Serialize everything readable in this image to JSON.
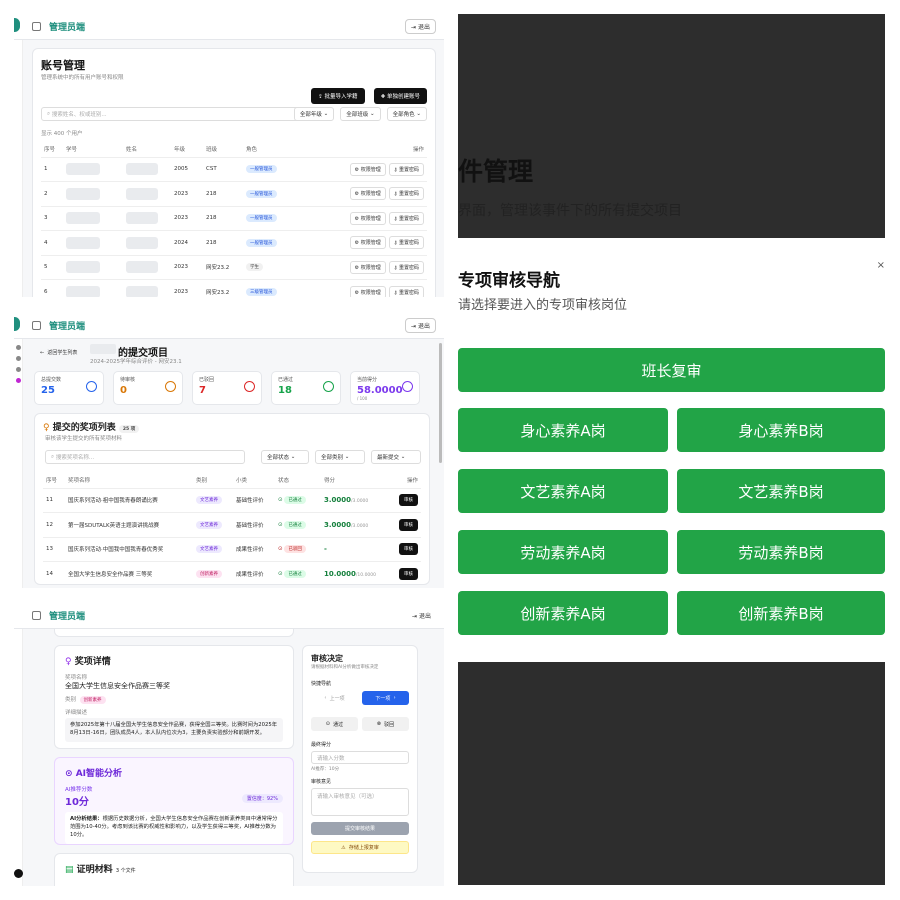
{
  "brand": "管理员端",
  "exit_label": "退出",
  "p1": {
    "title": "账号管理",
    "subtitle": "管理系统中的所有用户账号和权限",
    "btn_import": "批量导入学籍",
    "btn_create": "单独创建账号",
    "search_placeholder": "搜索姓名、权或班别...",
    "filters": [
      "全部年级",
      "全部班级",
      "全部角色"
    ],
    "count_text": "显示 400 个用户",
    "columns": [
      "序号",
      "学号",
      "姓名",
      "年级",
      "班级",
      "角色",
      "操作"
    ],
    "rows": [
      {
        "no": "1",
        "grade": "2005",
        "cls": "CST",
        "role": "一般管理员",
        "role_style": "blue"
      },
      {
        "no": "2",
        "grade": "2023",
        "cls": "218",
        "role": "一般管理员",
        "role_style": "blue"
      },
      {
        "no": "3",
        "grade": "2023",
        "cls": "218",
        "role": "一般管理员",
        "role_style": "blue"
      },
      {
        "no": "4",
        "grade": "2024",
        "cls": "218",
        "role": "一般管理员",
        "role_style": "blue"
      },
      {
        "no": "5",
        "grade": "2023",
        "cls": "网安23.2",
        "role": "学生",
        "role_style": "gray"
      },
      {
        "no": "6",
        "grade": "2023",
        "cls": "网安23.2",
        "role": "三级管理员",
        "role_style": "blue"
      }
    ],
    "op_perm": "权限管理",
    "op_reset": "重置密码"
  },
  "p2": {
    "back": "返回学生列表",
    "title": "的提交项目",
    "subtitle": "2024-2025学年综合评价 - 网安23.1",
    "stats": [
      {
        "label": "总提交数",
        "value": "25",
        "color": "#2563eb"
      },
      {
        "label": "待审核",
        "value": "0",
        "color": "#d97706"
      },
      {
        "label": "已驳回",
        "value": "7",
        "color": "#dc2626"
      },
      {
        "label": "已通过",
        "value": "18",
        "color": "#16a34a"
      },
      {
        "label": "当前得分",
        "value": "58.0000",
        "extra": "/ 100",
        "color": "#7c3aed"
      }
    ],
    "list_title": "提交的奖项列表",
    "list_badge": "25 项",
    "list_sub": "审核该学生提交的所有奖项材料",
    "search_placeholder": "搜索奖项名称...",
    "filters": [
      "全部状态",
      "全部类别",
      "最新提交"
    ],
    "columns": [
      "序号",
      "奖项名称",
      "类别",
      "小类",
      "状态",
      "得分",
      "操作"
    ],
    "rows": [
      {
        "no": "11",
        "name": "国庆系列活动·祖中国我青春朗诵比赛",
        "cat": "文艺素养",
        "cat_style": "purple",
        "sub": "基础性评价",
        "status": "已通过",
        "status_style": "green",
        "score": "3.0000",
        "max": "/3.0000"
      },
      {
        "no": "12",
        "name": "第一届SDUTALK英语主题演讲挑战赛",
        "cat": "文艺素养",
        "cat_style": "purple",
        "sub": "基础性评价",
        "status": "已通过",
        "status_style": "green",
        "score": "3.0000",
        "max": "/3.0000"
      },
      {
        "no": "13",
        "name": "国庆系列活动·中国我中国我青春优秀奖",
        "cat": "文艺素养",
        "cat_style": "purple",
        "sub": "成果性评价",
        "status": "已驳回",
        "status_style": "red",
        "score": "-",
        "max": ""
      },
      {
        "no": "14",
        "name": "全国大学生信息安全作品赛 三等奖",
        "cat": "创新素养",
        "cat_style": "pink",
        "sub": "成果性评价",
        "status": "已通过",
        "status_style": "green",
        "score": "10.0000",
        "max": "/10.0000"
      }
    ],
    "op": "审核"
  },
  "p3": {
    "award_title": "奖项详情",
    "name_label": "奖项名称",
    "name_value": "全国大学生信息安全作品赛三等奖",
    "cat_label": "类别",
    "cat_value": "创新素养",
    "desc_label": "详细描述",
    "desc_value": "参加2025年第十八届全国大学生信息安全作品赛，获得全国三等奖。比赛时间为2025年8月13日-16日，团队成员4人，本人队内位次为3，主要负责实验部分和前期开发。",
    "ai_title": "AI智能分析",
    "ai_score_label": "AI推荐分数",
    "ai_score": "10分",
    "ai_conf": "置信度：92%",
    "ai_result_label": "AI分析结果：",
    "ai_result": "根据历史数据分析，全国大学生信息安全作品赛在创新素养类目中通常得分范围为10-40分。考虑到该比赛的权威性和影响力，以及学生获得三等奖，AI推荐分数为10分。",
    "proof_title": "证明材料",
    "proof_badge": "3 个文件",
    "decide_title": "审核决定",
    "decide_sub": "请根据材料和AI分析做出审核决定",
    "quick_nav": "快捷导航",
    "prev": "上一项",
    "next": "下一项",
    "pass": "通过",
    "reject": "驳回",
    "score_label": "最终得分",
    "score_placeholder": "请输入分数",
    "ai_hint": "AI推荐：10分",
    "comment_label": "审核意见",
    "comment_placeholder": "请输入审核意见（可选）",
    "submit": "提交审核结果",
    "save": "存储上报复审"
  },
  "p4": {
    "head_title": "件管理",
    "head_sub": "界面，管理该事件下的所有提交项目",
    "nav_title": "专项审核导航",
    "nav_sub": "请选择要进入的专项审核岗位",
    "top_button": "班长复审",
    "buttons": [
      "身心素养A岗",
      "身心素养B岗",
      "文艺素养A岗",
      "文艺素养B岗",
      "劳动素养A岗",
      "劳动素养B岗",
      "创新素养A岗",
      "创新素养B岗"
    ]
  }
}
